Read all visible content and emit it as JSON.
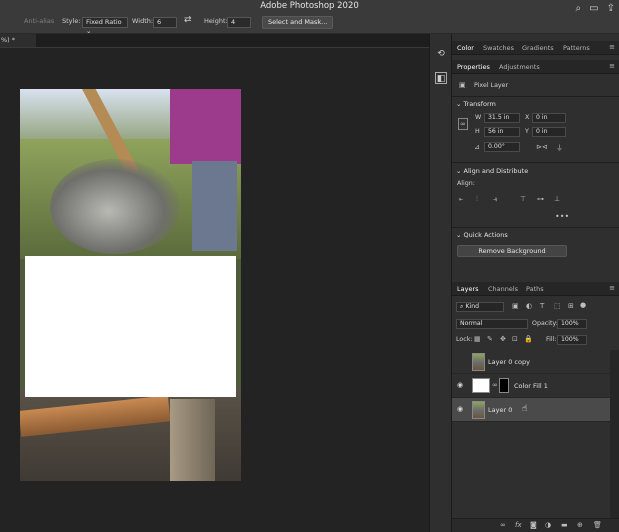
{
  "app": {
    "title": "Adobe Photoshop 2020"
  },
  "options_bar": {
    "anti_alias": "Anti-alias",
    "style_label": "Style:",
    "style_value": "Fixed Ratio",
    "width_label": "Width:",
    "width_value": "6",
    "height_label": "Height:",
    "height_value": "4",
    "select_mask": "Select and Mask..."
  },
  "document_tab": {
    "label": "%) *"
  },
  "panels": {
    "top_tabs": [
      "Color",
      "Swatches",
      "Gradients",
      "Patterns"
    ],
    "prop_tabs": [
      "Properties",
      "Adjustments"
    ],
    "pixel_layer": "Pixel Layer",
    "transform": {
      "header": "Transform",
      "w_label": "W",
      "w_value": "31.5 in",
      "x_label": "X",
      "x_value": "0 in",
      "h_label": "H",
      "h_value": "56 in",
      "y_label": "Y",
      "y_value": "0 in",
      "angle_value": "0.00°"
    },
    "align": {
      "header": "Align and Distribute",
      "align_label": "Align:"
    },
    "quick_actions": {
      "header": "Quick Actions",
      "remove_bg": "Remove Background"
    },
    "layers_tabs": [
      "Layers",
      "Channels",
      "Paths"
    ],
    "layers": {
      "kind": "Kind",
      "blend_mode": "Normal",
      "opacity_label": "Opacity:",
      "opacity_value": "100%",
      "lock_label": "Lock:",
      "fill_label": "Fill:",
      "fill_value": "100%",
      "items": [
        {
          "name": "Layer 0 copy",
          "visible": false,
          "selected": false
        },
        {
          "name": "Color Fill 1",
          "visible": true,
          "selected": false
        },
        {
          "name": "Layer 0",
          "visible": true,
          "selected": true
        }
      ]
    }
  }
}
